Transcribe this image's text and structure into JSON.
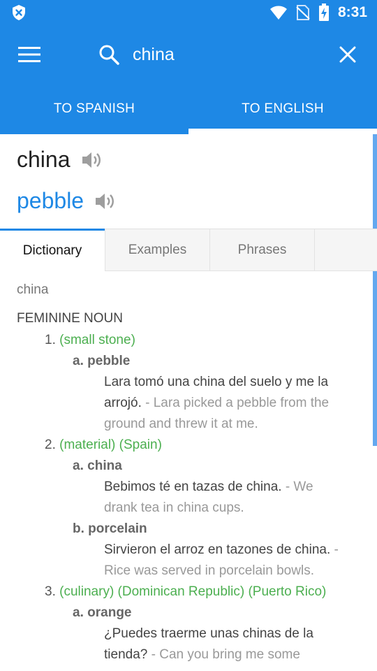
{
  "status": {
    "time": "8:31",
    "accent": "#1e88e5"
  },
  "search": {
    "query": "china"
  },
  "lang_tabs": [
    {
      "label": "TO SPANISH",
      "active": false
    },
    {
      "label": "TO ENGLISH",
      "active": true
    }
  ],
  "word": {
    "source": "china",
    "translation": "pebble"
  },
  "content_tabs": [
    {
      "label": "Dictionary",
      "active": true
    },
    {
      "label": "Examples",
      "active": false
    },
    {
      "label": "Phrases",
      "active": false
    }
  ],
  "entry": {
    "headword": "china",
    "pos": "FEMININE NOUN",
    "senses": [
      {
        "num": "1.",
        "context": "(small stone)",
        "translations": [
          {
            "letter": "a.",
            "word": "pebble",
            "example_lines": [
              {
                "src": "Lara tomó una china del suelo y me la",
                "tr": ""
              },
              {
                "src": "arrojó.",
                "tr": " - Lara picked a pebble from the"
              },
              {
                "src": "",
                "tr": "ground and threw it at me."
              }
            ]
          }
        ]
      },
      {
        "num": "2.",
        "context": "(material) (Spain)",
        "translations": [
          {
            "letter": "a.",
            "word": "china",
            "example_lines": [
              {
                "src": "Bebimos té en tazas de china.",
                "tr": " - We"
              },
              {
                "src": "",
                "tr": "drank tea in china cups."
              }
            ]
          },
          {
            "letter": "b.",
            "word": "porcelain",
            "example_lines": [
              {
                "src": "Sirvieron el arroz en tazones de china.",
                "tr": " -"
              },
              {
                "src": "",
                "tr": "Rice was served in porcelain bowls."
              }
            ]
          }
        ]
      },
      {
        "num": "3.",
        "context": "(culinary) (Dominican Republic) (Puerto Rico)",
        "translations": [
          {
            "letter": "a.",
            "word": "orange",
            "example_lines": [
              {
                "src": "¿Puedes traerme unas chinas de la",
                "tr": ""
              },
              {
                "src": "tienda?",
                "tr": " - Can you bring me some"
              }
            ]
          }
        ]
      }
    ]
  }
}
